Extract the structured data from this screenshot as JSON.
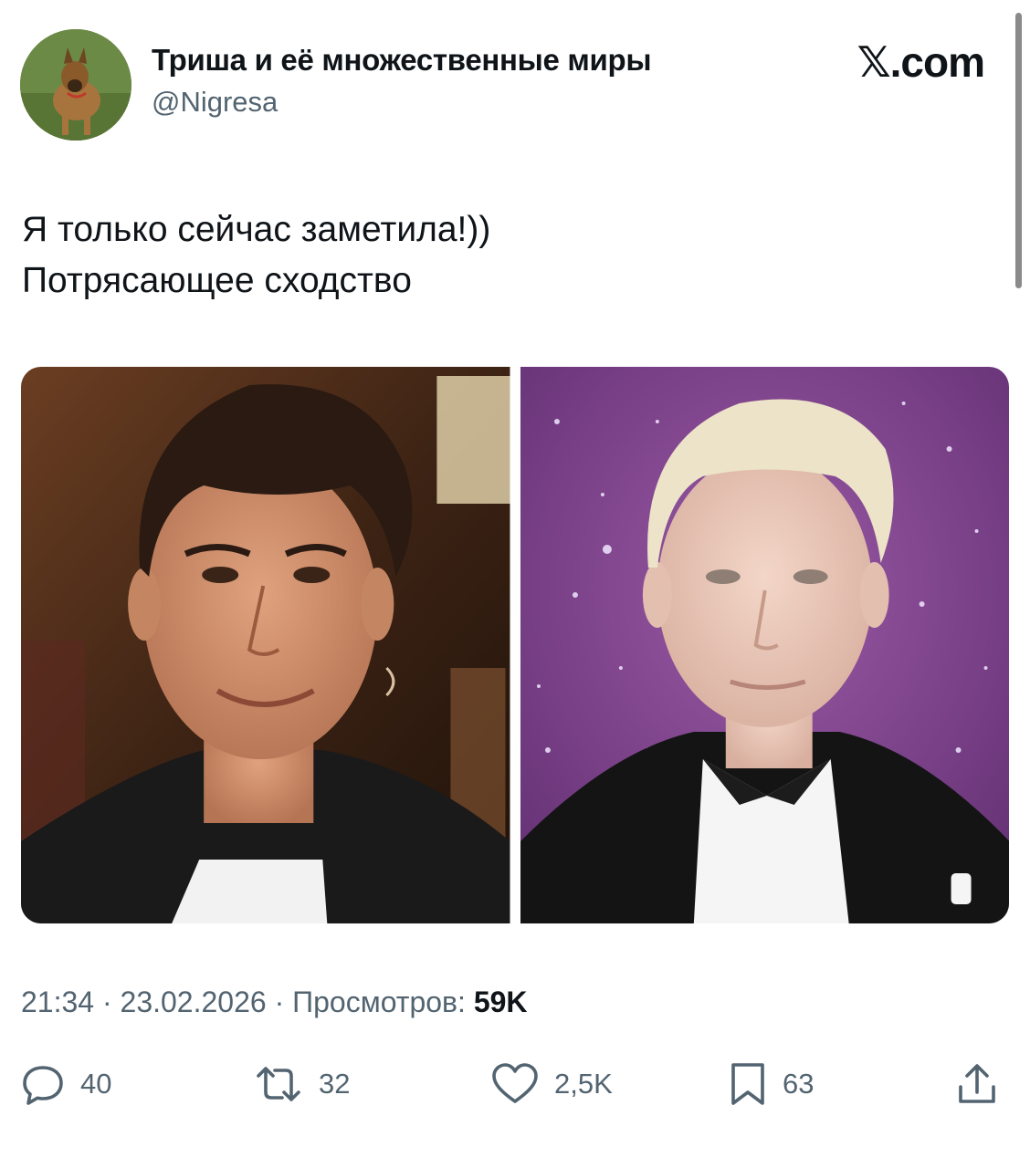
{
  "author": {
    "display_name": "Триша и её множественные миры",
    "handle": "@Nigresa"
  },
  "brand": {
    "label": "𝕏.com"
  },
  "tweet": {
    "lines": [
      "Я только сейчас заметила!))",
      "Потрясающее сходство"
    ]
  },
  "meta": {
    "time": "21:34",
    "separator": " · ",
    "date": "23.02.2026",
    "views_label": "Просмотров: ",
    "views_count": "59K"
  },
  "actions": {
    "replies": "40",
    "reposts": "32",
    "likes": "2,5K",
    "bookmarks": "63"
  },
  "icons": {
    "reply": "reply-icon",
    "repost": "repost-icon",
    "like": "heart-icon",
    "bookmark": "bookmark-icon",
    "share": "share-icon"
  },
  "colors": {
    "text": "#0f1419",
    "secondary": "#536471",
    "background": "#ffffff"
  }
}
